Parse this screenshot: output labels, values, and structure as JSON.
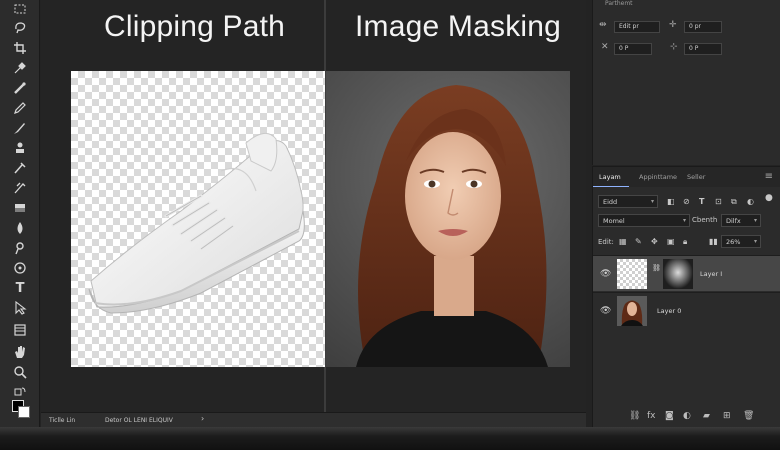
{
  "canvas": {
    "title_left": "Clipping Path",
    "title_right": "Image Masking"
  },
  "toolbar": {
    "tools": [
      "marquee-tool",
      "lasso-tool",
      "crop-tool",
      "eyedropper-tool",
      "spot-healing-tool",
      "brush-tool",
      "clone-stamp-tool",
      "history-brush-tool",
      "eraser-tool",
      "gradient-tool",
      "blur-tool",
      "dodge-tool",
      "pen-tool",
      "type-tool",
      "path-selection-tool",
      "rectangle-tool",
      "hand-tool",
      "zoom-tool"
    ],
    "type_tool_glyph": "T"
  },
  "statusbar": {
    "left_text": "Ticlle Lin",
    "mid_text": "Detor OL LENI ELIQUIV",
    "arrow": "›"
  },
  "properties": {
    "header": "Parthemt",
    "field1": "Edit pr",
    "field2": "0 pr",
    "field3": "0 P",
    "field4": "0 P"
  },
  "layers_panel": {
    "tabs": [
      "Layam",
      "Appinttame",
      "Seller"
    ],
    "kind_dropdown": "Eidd",
    "blend_dropdown": "Momel",
    "opacity_label": "Cbenth",
    "fill_label": "Dilfx",
    "lock_label": "Edit:",
    "fill_value": "26%",
    "layers": [
      {
        "name": "Layer I",
        "selected": true
      },
      {
        "name": "Layer 0",
        "selected": false
      }
    ]
  },
  "colors": {
    "panel_bg": "#2b2b2b",
    "canvas_bg": "#242424",
    "accent": "#8fb3ff"
  }
}
